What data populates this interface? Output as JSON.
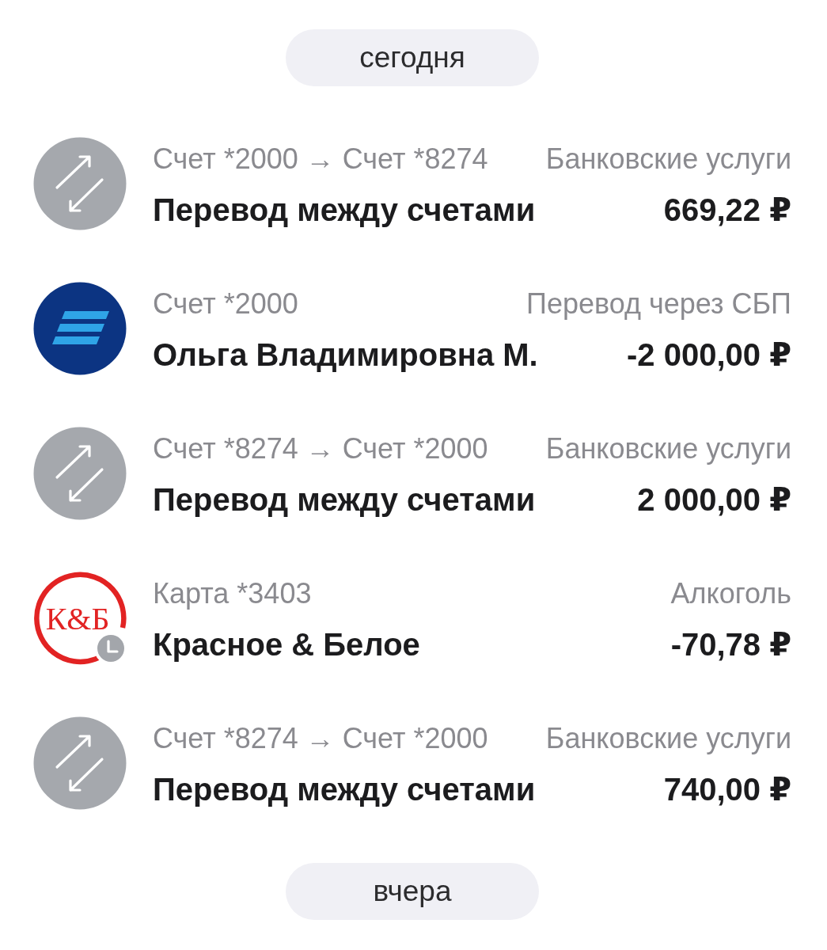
{
  "feed": [
    {
      "kind": "date",
      "label": "сегодня"
    },
    {
      "kind": "transfer",
      "account": "Счет *2000 → Счет *8274",
      "category": "Банковские услуги",
      "title": "Перевод между счетами",
      "amount": "669,22 ₽",
      "pending": false
    },
    {
      "kind": "sbp_payment",
      "account": "Счет *2000",
      "category": "Перевод через СБП",
      "title": "Ольга Владимировна М.",
      "amount": "-2 000,00 ₽",
      "pending": false
    },
    {
      "kind": "transfer",
      "account": "Счет *8274 → Счет *2000",
      "category": "Банковские услуги",
      "title": "Перевод между счетами",
      "amount": "2 000,00 ₽",
      "pending": false
    },
    {
      "kind": "card_purchase",
      "logo_text": "К&Б",
      "account": "Карта *3403",
      "category": "Алкоголь",
      "title": "Красное & Белое",
      "amount": "-70,78 ₽",
      "pending": true
    },
    {
      "kind": "transfer",
      "account": "Счет *8274 → Счет *2000",
      "category": "Банковские услуги",
      "title": "Перевод между счетами",
      "amount": "740,00 ₽",
      "pending": false
    },
    {
      "kind": "date",
      "label": "вчера"
    }
  ]
}
